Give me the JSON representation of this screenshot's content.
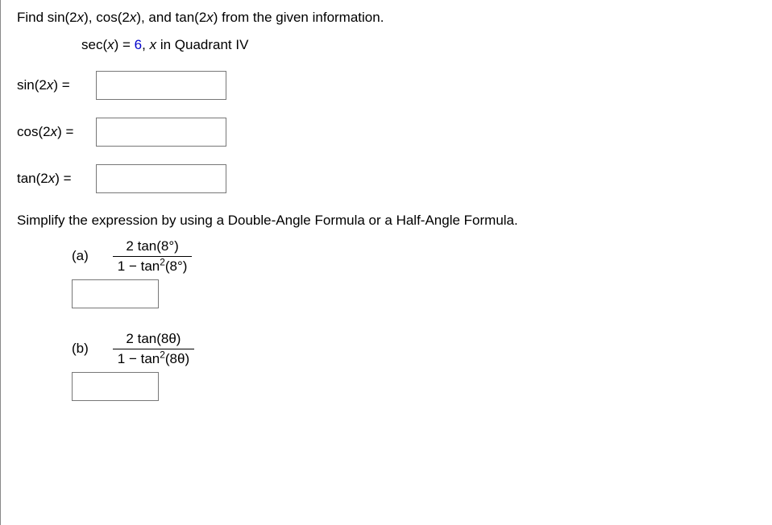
{
  "question1": {
    "prompt_prefix": "Find sin(2",
    "prompt_mid1": "), cos(2",
    "prompt_mid2": "), and tan(2",
    "prompt_suffix": ") from the given information.",
    "given_prefix": "sec(",
    "given_mid": ") = ",
    "given_value": "6",
    "given_suffix": ",   ",
    "given_quadrant": " in Quadrant IV",
    "var": "x",
    "rows": [
      {
        "label_prefix": "sin(2",
        "label_suffix": ")  ="
      },
      {
        "label_prefix": "cos(2",
        "label_suffix": ") ="
      },
      {
        "label_prefix": "tan(2",
        "label_suffix": ") ="
      }
    ]
  },
  "question2": {
    "prompt": "Simplify the expression by using a Double-Angle Formula or a Half-Angle Formula.",
    "parts": [
      {
        "label": "(a)",
        "num": "2 tan(8°)",
        "den_prefix": "1 − tan",
        "den_sup": "2",
        "den_suffix": "(8°)"
      },
      {
        "label": "(b)",
        "num": "2 tan(8θ)",
        "den_prefix": "1 − tan",
        "den_sup": "2",
        "den_suffix": "(8θ)"
      }
    ]
  }
}
